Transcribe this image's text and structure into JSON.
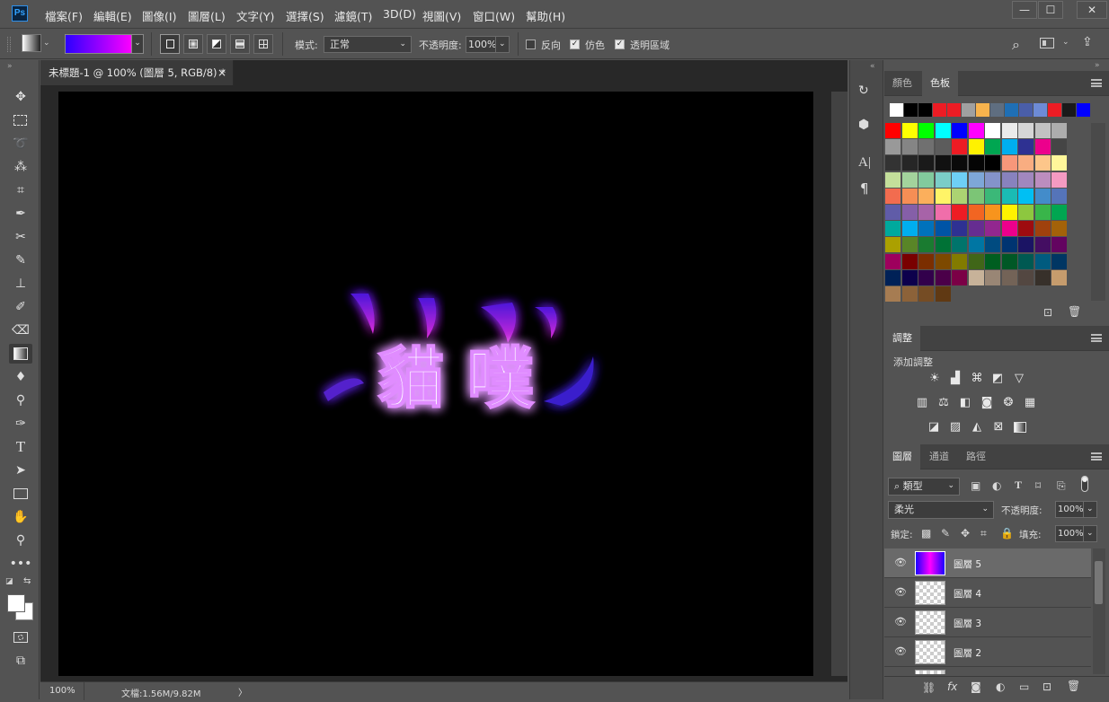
{
  "app": {
    "logo": "Ps"
  },
  "menu": [
    "檔案(F)",
    "編輯(E)",
    "圖像(I)",
    "圖層(L)",
    "文字(Y)",
    "選擇(S)",
    "濾鏡(T)",
    "3D(D)",
    "視圖(V)",
    "窗口(W)",
    "幫助(H)"
  ],
  "window_controls": {
    "minimize": "—",
    "maximize": "☐",
    "close": "✕"
  },
  "options": {
    "mode_label": "模式:",
    "mode_value": "正常",
    "opacity_label": "不透明度:",
    "opacity_value": "100%",
    "reverse_label": "反向",
    "dither_label": "仿色",
    "transparency_label": "透明區域",
    "reverse_checked": false,
    "dither_checked": true,
    "transparency_checked": true
  },
  "document": {
    "tab_title": "未標題-1 @ 100% (圖層 5, RGB/8) *",
    "tab_close": "×",
    "canvas_text": "貓 噗"
  },
  "status": {
    "zoom": "100%",
    "doc_info": "文檔:1.56M/9.82M",
    "arrow": "〉"
  },
  "swatches_panel": {
    "tabs": [
      "顏色",
      "色板"
    ],
    "active_tab": "色板",
    "recent_colors": [
      "#ffffff",
      "#000000",
      "#000000",
      "#ed1c24",
      "#ed1c24",
      "#a0a0a0",
      "#f7b34d",
      "#5f6e80",
      "#1f6fb5",
      "#4a5ea8",
      "#6d8bd6",
      "#ed1c24",
      "#1a1a1a",
      "#0000ff"
    ],
    "grid_colors": [
      "#ff0000",
      "#ffff00",
      "#00ff00",
      "#00ffff",
      "#0000ff",
      "#ff00ff",
      "#ffffff",
      "#ebebeb",
      "#d6d6d6",
      "#c2c2c2",
      "#adadad",
      "#999999",
      "#858585",
      "#707070",
      "#5c5c5c",
      "#ed1c24",
      "#fff200",
      "#00a651",
      "#00aeef",
      "#2e3192",
      "#ec008c",
      "#454545",
      "#333333",
      "#262626",
      "#1a1a1a",
      "#111111",
      "#0a0a0a",
      "#050505",
      "#000000",
      "#f7977a",
      "#f9ad81",
      "#fdc68a",
      "#fff79a",
      "#c4df9b",
      "#a3d39c",
      "#82ca9d",
      "#7bcdc8",
      "#6ecff6",
      "#7ea7d8",
      "#8493ca",
      "#8882be",
      "#a187be",
      "#bc8dbf",
      "#f49ac2",
      "#f26c4f",
      "#f68e55",
      "#fbaf5c",
      "#fff467",
      "#acd372",
      "#7cc576",
      "#3bb878",
      "#1abbb4",
      "#00bff3",
      "#438cca",
      "#5574b9",
      "#605ca8",
      "#855fa8",
      "#a763a8",
      "#f06eaa",
      "#ed1c24",
      "#f26522",
      "#f7941d",
      "#fff200",
      "#8dc73f",
      "#39b54a",
      "#00a651",
      "#00a99d",
      "#00aeef",
      "#0072bc",
      "#0054a6",
      "#2e3192",
      "#662d91",
      "#92278f",
      "#ec008c",
      "#9e0b0f",
      "#a0410d",
      "#a36209",
      "#aba000",
      "#598527",
      "#1a7b30",
      "#007236",
      "#00746b",
      "#0076a3",
      "#004b80",
      "#003471",
      "#1b1464",
      "#440e62",
      "#630460",
      "#9e005d",
      "#790000",
      "#7b2e00",
      "#7d4900",
      "#827b00",
      "#406618",
      "#005e20",
      "#005826",
      "#005952",
      "#005b7f",
      "#003663",
      "#002157",
      "#0d004c",
      "#32004b",
      "#4b0049",
      "#7b0046",
      "#c7b299",
      "#998675",
      "#736357",
      "#534741",
      "#37302a",
      "#c69c6d",
      "#a67c52",
      "#8c6239",
      "#754c24",
      "#603913"
    ]
  },
  "adjustments_panel": {
    "tab": "調整",
    "subtitle": "添加調整",
    "icons": [
      "brightness-contrast",
      "levels",
      "curves",
      "exposure",
      "vibrance",
      "hue-saturation",
      "color-balance",
      "black-white",
      "photo-filter",
      "channel-mixer",
      "color-lookup",
      "invert",
      "posterize",
      "threshold",
      "selective-color",
      "gradient-map"
    ]
  },
  "layers_panel": {
    "tabs": [
      "圖層",
      "通道",
      "路徑"
    ],
    "active_tab": "圖層",
    "filter_label": "類型",
    "blend_mode": "柔光",
    "opacity_label": "不透明度:",
    "opacity_value": "100%",
    "lock_label": "鎖定:",
    "fill_label": "填充:",
    "fill_value": "100%",
    "layers": [
      {
        "name": "圖層 5",
        "selected": true,
        "thumb": "gradient"
      },
      {
        "name": "圖層 4",
        "selected": false,
        "thumb": "transparent"
      },
      {
        "name": "圖層 3",
        "selected": false,
        "thumb": "transparent"
      },
      {
        "name": "圖層 2",
        "selected": false,
        "thumb": "transparent"
      }
    ],
    "bottom_icons": [
      "link-icon",
      "fx-icon",
      "mask-icon",
      "adjustment-icon",
      "group-icon",
      "new-layer-icon",
      "trash-icon"
    ]
  },
  "colors": {
    "ui_bg": "#535353",
    "dark_bg": "#282828",
    "gradient_start": "#2b00ff",
    "gradient_end": "#ff00ff",
    "glow": "#b05cff"
  }
}
